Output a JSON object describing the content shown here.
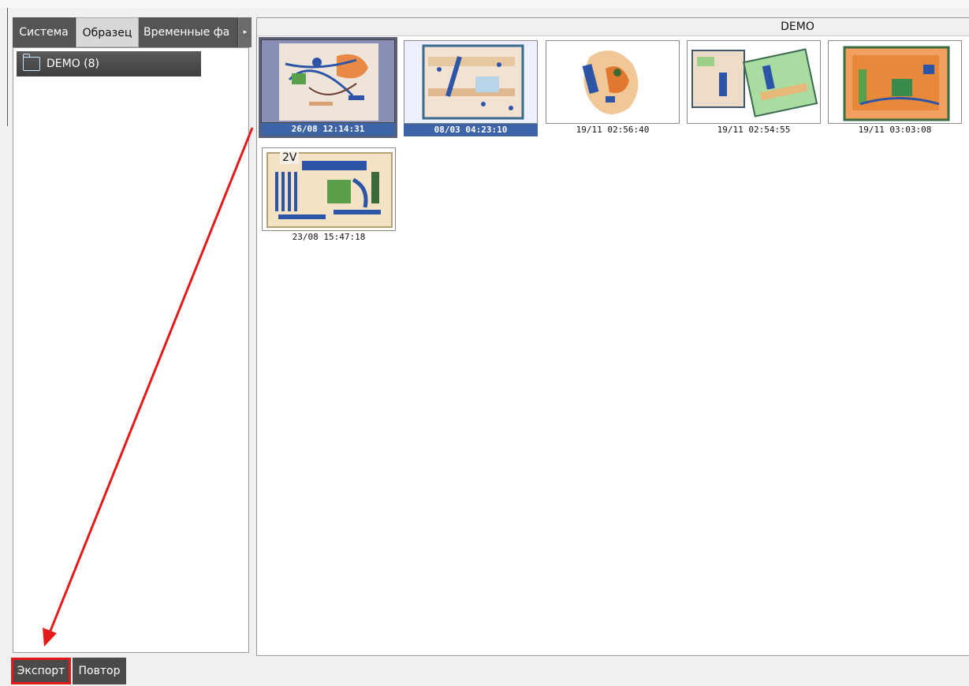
{
  "tabs": [
    {
      "label": "Система"
    },
    {
      "label": "Образец"
    },
    {
      "label": "Временные фа"
    }
  ],
  "tab_scroll_icon": "chevron-right-icon",
  "tree": {
    "folder_label": "DEMO (8)",
    "folder_icon": "folder-icon"
  },
  "gallery": {
    "header": "DEMO",
    "thumbnails": [
      {
        "caption": "26/08 12:14:31",
        "selected": true
      },
      {
        "caption": "08/03 04:23:10",
        "selected": true
      },
      {
        "caption": "19/11 02:56:40",
        "selected": false
      },
      {
        "caption": "19/11 02:54:55",
        "selected": false
      },
      {
        "caption": "19/11 03:03:08",
        "selected": false
      },
      {
        "caption": "23/08 15:47:18",
        "selected": false,
        "badge": "2V"
      }
    ]
  },
  "buttons": {
    "export_label": "Экспорт",
    "repeat_label": "Повтор"
  },
  "colors": {
    "selection": "#3e64a8",
    "annotation": "#e21a1a",
    "xray_orange": "#e8884a",
    "xray_blue": "#2c55a8",
    "xray_green": "#5aa04a"
  }
}
